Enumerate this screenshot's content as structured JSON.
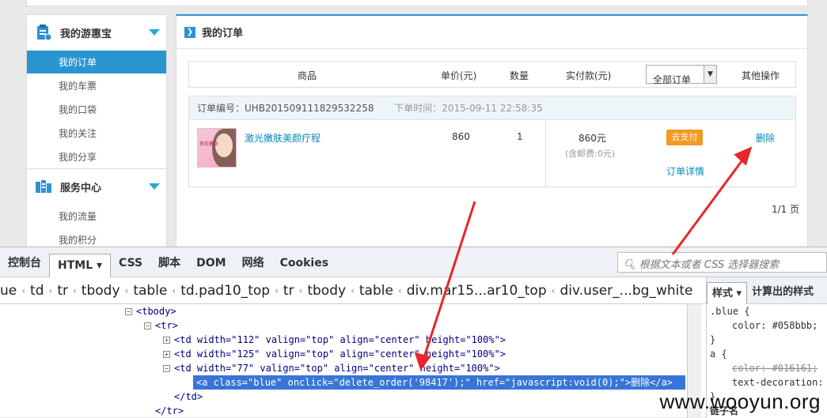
{
  "sidebar": {
    "section1_title": "我的游惠宝",
    "items1": [
      "我的订单",
      "我的车票",
      "我的口袋",
      "我的关注",
      "我的分享"
    ],
    "section2_title": "服务中心",
    "items2": [
      "我的流量",
      "我的积分"
    ]
  },
  "main": {
    "title": "我的订单",
    "columns": [
      "商品",
      "单价(元)",
      "数量",
      "实付款(元)",
      "其他操作"
    ],
    "filter_value": "全部订单",
    "order": {
      "number_label": "订单编号：UHB201509111829532258",
      "time_label": "下单时间：2015-09-11 22:58:35",
      "product_name": "激光嫩肤美颜疗程",
      "thumb_text": "美白嫩肤",
      "price": "860",
      "quantity": "1",
      "paid": "860元",
      "shipping": "(含邮费:0元)",
      "pay_button": "去支付",
      "delete_link": "删除",
      "detail_link": "订单详情"
    },
    "pager": "1/1 页"
  },
  "devtools": {
    "tabs": [
      "控制台",
      "HTML",
      "CSS",
      "脚本",
      "DOM",
      "网络",
      "Cookies"
    ],
    "search_placeholder": "根据文本或者 CSS 选择器搜索",
    "breadcrumbs": [
      "ue",
      "td",
      "tr",
      "tbody",
      "table",
      "td.pad10_top",
      "tr",
      "tbody",
      "table",
      "div.mar15...ar10_top",
      "div.user_...bg_white"
    ],
    "right_tabs": [
      "样式",
      "计算出的样式"
    ],
    "code_lines": [
      "<tbody>",
      "<tr>",
      "<td width=\"112\" valign=\"top\" align=\"center\" height=\"100%\">",
      "<td width=\"125\" valign=\"top\" align=\"center\" height=\"100%\">",
      "<td width=\"77\" valign=\"top\" align=\"center\" height=\"100%\">",
      "<a class=\"blue\" onclick=\"delete_order('98417');\" href=\"javascript:void(0);\">删除</a>",
      "</td>",
      "</tr>"
    ],
    "styles_lines": [
      ".blue {",
      "color: #058bbb;",
      "}",
      "a {",
      "color: #016161;",
      "text-decoration:",
      "}",
      "链子名"
    ]
  },
  "watermark": "www.wooyun.org",
  "colors": {
    "accent": "#2a94d0",
    "link": "#058bbb",
    "pay": "#f19a24",
    "arrow": "#e8262a"
  }
}
